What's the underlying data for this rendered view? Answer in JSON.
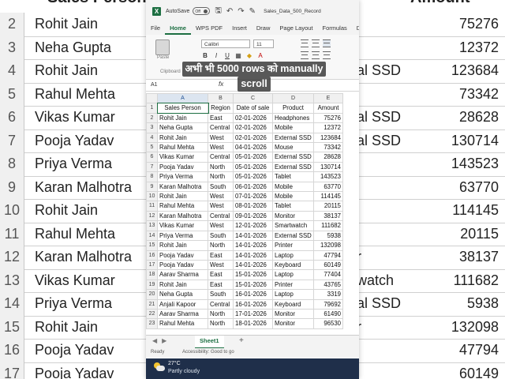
{
  "background": {
    "headers": [
      "Sales Person",
      "Amount"
    ],
    "rows": [
      {
        "num": "2",
        "name": "Rohit Jain",
        "product": "",
        "amount": "75276"
      },
      {
        "num": "3",
        "name": "Neha Gupta",
        "product": "",
        "amount": "12372"
      },
      {
        "num": "4",
        "name": "Rohit Jain",
        "product": "al SSD",
        "amount": "123684"
      },
      {
        "num": "5",
        "name": "Rahul Mehta",
        "product": "",
        "amount": "73342"
      },
      {
        "num": "6",
        "name": "Vikas Kumar",
        "product": "al SSD",
        "amount": "28628"
      },
      {
        "num": "7",
        "name": "Pooja Yadav",
        "product": "al SSD",
        "amount": "130714"
      },
      {
        "num": "8",
        "name": "Priya Verma",
        "product": "",
        "amount": "143523"
      },
      {
        "num": "9",
        "name": "Karan Malhotra",
        "product": "",
        "amount": "63770"
      },
      {
        "num": "10",
        "name": "Rohit Jain",
        "product": "",
        "amount": "114145"
      },
      {
        "num": "11",
        "name": "Rahul Mehta",
        "product": "",
        "amount": "20115"
      },
      {
        "num": "12",
        "name": "Karan Malhotra",
        "product": "r",
        "amount": "38137"
      },
      {
        "num": "13",
        "name": "Vikas Kumar",
        "product": "watch",
        "amount": "111682"
      },
      {
        "num": "14",
        "name": "Priya Verma",
        "product": "al SSD",
        "amount": "5938"
      },
      {
        "num": "15",
        "name": "Rohit Jain",
        "product": "r",
        "amount": "132098"
      },
      {
        "num": "16",
        "name": "Pooja Yadav",
        "product": "",
        "amount": "47794"
      },
      {
        "num": "17",
        "name": "Pooja Yadav",
        "product": "",
        "amount": "60149"
      }
    ]
  },
  "titlebar": {
    "app_icon": "excel-icon",
    "autosave": "AutoSave",
    "toggle": "Off",
    "filename": "Sales_Data_500_Record"
  },
  "menu": [
    "File",
    "Home",
    "WPS PDF",
    "Insert",
    "Draw",
    "Page Layout",
    "Formulas",
    "D"
  ],
  "ribbon": {
    "paste": "Paste",
    "clipboard": "Clipboard",
    "font_name": "Calibri",
    "font_size": "11",
    "alignment_label": "Ali"
  },
  "overlay": {
    "line1": "अभी भी 5000 rows को manually",
    "line2": "scroll"
  },
  "formula_bar": {
    "name_box": "A1",
    "fx": "fx"
  },
  "sheet": {
    "columns": [
      "A",
      "B",
      "C",
      "D",
      "E"
    ],
    "headers": [
      "Sales Person",
      "Region",
      "Date of sale",
      "Product",
      "Amount"
    ],
    "rows": [
      [
        "Rohit Jain",
        "East",
        "02-01-2026",
        "Headphones",
        "75276"
      ],
      [
        "Neha Gupta",
        "Central",
        "02-01-2026",
        "Mobile",
        "12372"
      ],
      [
        "Rohit Jain",
        "West",
        "02-01-2026",
        "External SSD",
        "123684"
      ],
      [
        "Rahul Mehta",
        "West",
        "04-01-2026",
        "Mouse",
        "73342"
      ],
      [
        "Vikas Kumar",
        "Central",
        "05-01-2026",
        "External SSD",
        "28628"
      ],
      [
        "Pooja Yadav",
        "North",
        "05-01-2026",
        "External SSD",
        "130714"
      ],
      [
        "Priya Verma",
        "North",
        "05-01-2026",
        "Tablet",
        "143523"
      ],
      [
        "Karan Malhotra",
        "South",
        "06-01-2026",
        "Mobile",
        "63770"
      ],
      [
        "Rohit Jain",
        "West",
        "07-01-2026",
        "Mobile",
        "114145"
      ],
      [
        "Rahul Mehta",
        "West",
        "08-01-2026",
        "Tablet",
        "20115"
      ],
      [
        "Karan Malhotra",
        "Central",
        "09-01-2026",
        "Monitor",
        "38137"
      ],
      [
        "Vikas Kumar",
        "West",
        "12-01-2026",
        "Smartwatch",
        "111682"
      ],
      [
        "Priya Verma",
        "South",
        "14-01-2026",
        "External SSD",
        "5938"
      ],
      [
        "Rohit Jain",
        "North",
        "14-01-2026",
        "Printer",
        "132098"
      ],
      [
        "Pooja Yadav",
        "East",
        "14-01-2026",
        "Laptop",
        "47794"
      ],
      [
        "Pooja Yadav",
        "West",
        "14-01-2026",
        "Keyboard",
        "60149"
      ],
      [
        "Aarav Sharma",
        "East",
        "15-01-2026",
        "Laptop",
        "77404"
      ],
      [
        "Rohit Jain",
        "East",
        "15-01-2026",
        "Printer",
        "43765"
      ],
      [
        "Neha Gupta",
        "South",
        "16-01-2026",
        "Laptop",
        "3319"
      ],
      [
        "Anjali Kapoor",
        "Central",
        "16-01-2026",
        "Keyboard",
        "79692"
      ],
      [
        "Aarav Sharma",
        "North",
        "17-01-2026",
        "Monitor",
        "61490"
      ],
      [
        "Rahul Mehta",
        "North",
        "18-01-2026",
        "Monitor",
        "96530"
      ]
    ]
  },
  "sheet_tab": "Sheet1",
  "status": {
    "ready": "Ready",
    "accessibility": "Accessibility: Good to go"
  },
  "taskbar": {
    "temperature": "27°C",
    "condition": "Partly cloudy"
  }
}
